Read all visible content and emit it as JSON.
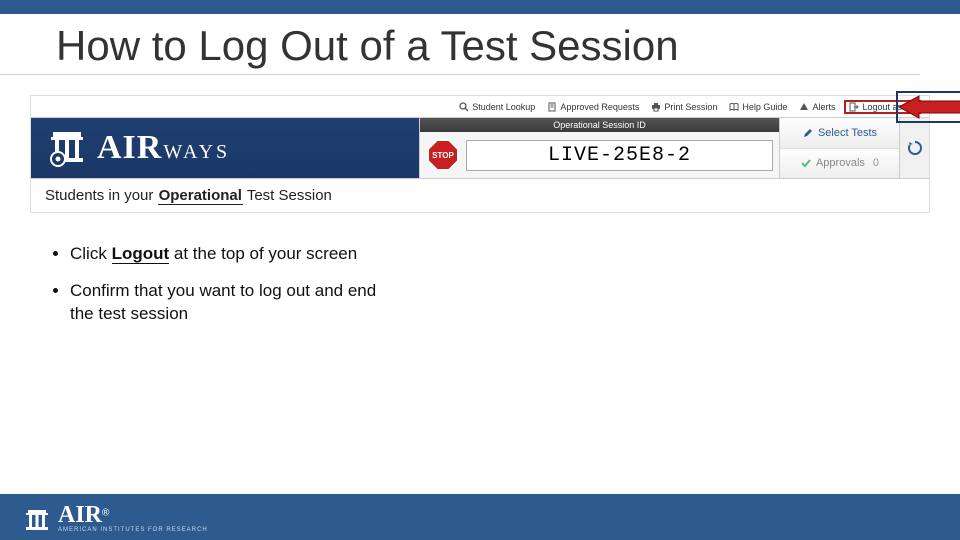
{
  "slide": {
    "title": "How to Log Out of a Test Session"
  },
  "toolbar": {
    "student_lookup": "Student Lookup",
    "approved_requests": "Approved Requests",
    "print_session": "Print Session",
    "help_guide": "Help Guide",
    "alerts": "Alerts",
    "logout": "Logout as Do"
  },
  "brand": {
    "air": "AIR",
    "ways": "WAYS"
  },
  "session": {
    "header": "Operational Session ID",
    "stop": "STOP",
    "id": "LIVE-25E8-2"
  },
  "side": {
    "select_tests": "Select Tests",
    "approvals": "Approvals",
    "approvals_count": "0"
  },
  "students_row": {
    "pre": "Students in your ",
    "op": "Operational",
    "post": " Test Session"
  },
  "bullets": {
    "b1_pre": "Click ",
    "b1_em": "Logout",
    "b1_post": " at the top of your screen",
    "b2": "Confirm that you want to log out and end the test session"
  },
  "footer": {
    "air": "AIR",
    "sub": "AMERICAN INSTITUTES FOR RESEARCH"
  }
}
